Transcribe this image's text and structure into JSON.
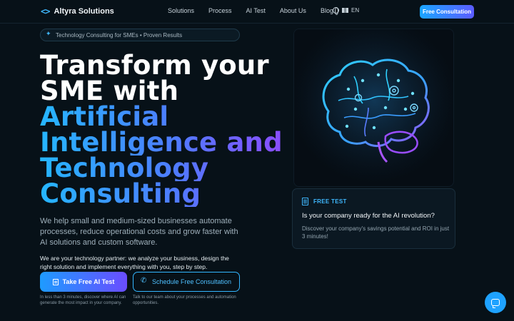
{
  "nav": {
    "logo_mark": "<>",
    "brand": "Altyra Solutions",
    "links": [
      "Solutions",
      "Process",
      "AI Test",
      "About Us",
      "Blog"
    ],
    "lang": "EN",
    "cta": "Free Consultation"
  },
  "hero": {
    "badge": "Technology Consulting for SMEs • Proven Results",
    "title_white": [
      "Transform your",
      "SME with"
    ],
    "title_gradient": [
      "Artificial",
      "Intelligence and",
      "Technology",
      "Consulting"
    ],
    "lead": "We help small and medium-sized businesses automate processes, reduce operational costs and grow faster with AI solutions and custom software.",
    "partner": "We are your technology partner: we analyze your business, design the right solution and implement everything with you, step by step.",
    "primary_button": "Take Free AI Test",
    "primary_sub": "In less than 3 minutes, discover where AI can generate the most impact in your company.",
    "secondary_button": "Schedule Free Consultation",
    "secondary_sub": "Talk to our team about your processes and automation opportunities."
  },
  "test_card": {
    "tag": "FREE TEST",
    "title": "Is your company ready for the AI revolution?",
    "description": "Discover your company's savings potential and ROI in just 3 minutes!"
  },
  "colors": {
    "background": "#071118",
    "accent": "#1ea2ff",
    "accent_purple": "#6a4dff"
  },
  "icons": [
    "code-icon",
    "globe-icon",
    "flag-icon",
    "sparkle-icon",
    "list-icon",
    "phone-icon",
    "document-icon",
    "chat-icon"
  ]
}
